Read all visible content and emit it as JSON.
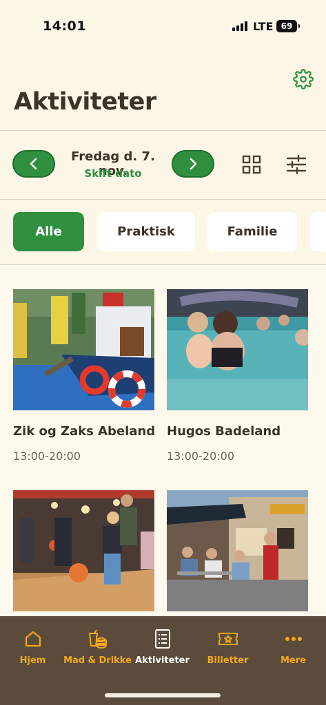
{
  "status": {
    "time": "14:01",
    "network": "LTE",
    "battery": "69"
  },
  "header": {
    "title": "Aktiviteter"
  },
  "date_nav": {
    "date": "Fredag d. 7. nov.",
    "change_date": "Skift dato"
  },
  "filters": [
    {
      "label": "Alle",
      "active": true
    },
    {
      "label": "Praktisk",
      "active": false
    },
    {
      "label": "Familie",
      "active": false
    }
  ],
  "activities": [
    {
      "title": "Zik og Zaks Abeland",
      "time": "13:00-20:00"
    },
    {
      "title": "Hugos Badeland",
      "time": "13:00-20:00"
    },
    {
      "title": "",
      "time": ""
    },
    {
      "title": "",
      "time": ""
    }
  ],
  "tabs": [
    {
      "label": "Hjem",
      "icon": "home-icon",
      "active": false
    },
    {
      "label": "Mad & Drikke",
      "icon": "food-icon",
      "active": false
    },
    {
      "label": "Aktiviteter",
      "icon": "activities-icon",
      "active": true
    },
    {
      "label": "Billetter",
      "icon": "ticket-icon",
      "active": false
    },
    {
      "label": "Mere",
      "icon": "more-icon",
      "active": false
    }
  ],
  "colors": {
    "background": "#fbf6e6",
    "accent": "#2f8f3f",
    "tabbar": "#5b4b3a",
    "tab_label": "#f2a81c"
  }
}
